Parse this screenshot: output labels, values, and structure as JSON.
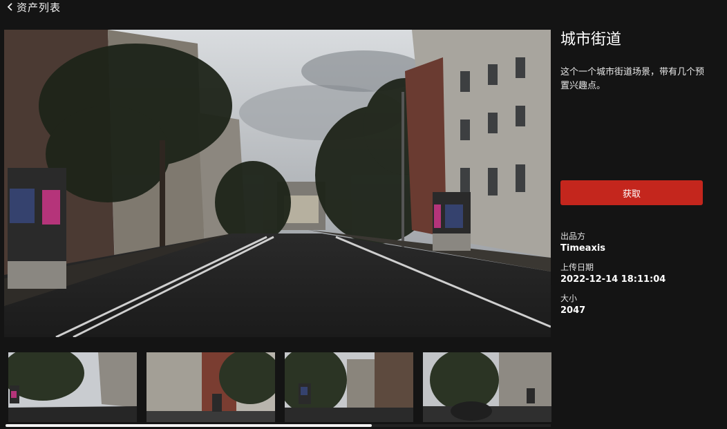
{
  "header": {
    "back_label": "资产列表"
  },
  "asset": {
    "title": "城市街道",
    "description": "这个一个城市街道场景，带有几个预置兴趣点。",
    "get_button": "获取",
    "meta": [
      {
        "label": "出品方",
        "value": "Timeaxis"
      },
      {
        "label": "上传日期",
        "value": "2022-12-14 18:11:04"
      },
      {
        "label": "大小",
        "value": "2047"
      }
    ]
  },
  "thumbnails": [
    "street-view-1",
    "street-view-2",
    "street-view-3",
    "street-view-4"
  ],
  "colors": {
    "background": "#141414",
    "accent": "#c4261d",
    "text": "#ffffff"
  },
  "icons": {
    "back": "chevron-left-icon"
  }
}
